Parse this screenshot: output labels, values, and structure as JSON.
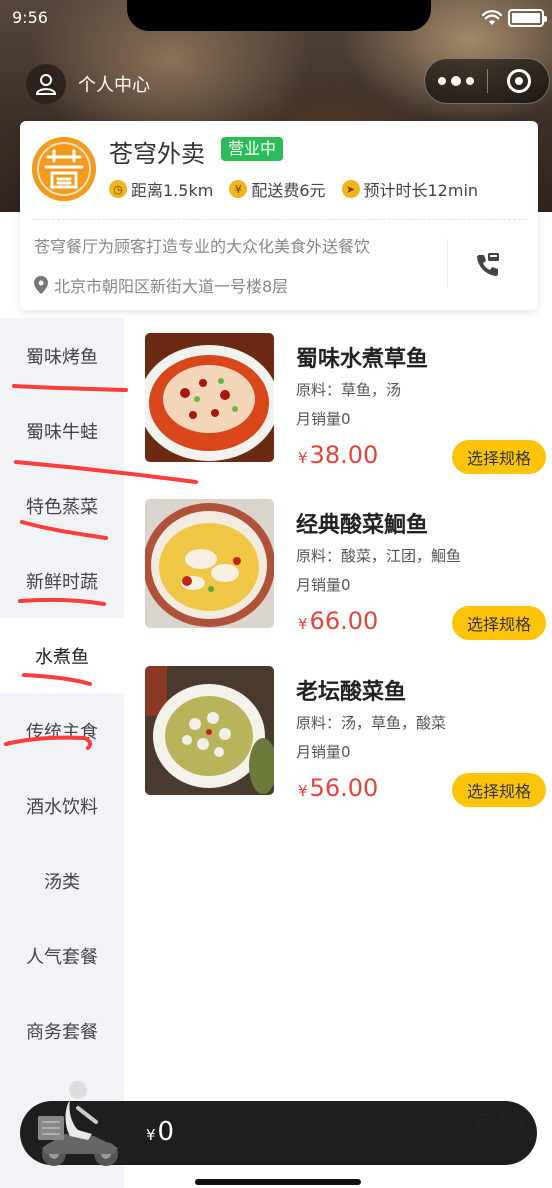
{
  "status_bar": {
    "time": "9:56"
  },
  "header": {
    "user_center_label": "个人中心"
  },
  "shop": {
    "name": "苍穹外卖",
    "status_badge": "营业中",
    "distance": "距离1.5km",
    "delivery_fee": "配送费6元",
    "eta": "预计时长12min",
    "description": "苍穹餐厅为顾客打造专业的大众化美食外送餐饮",
    "address": "北京市朝阳区新街大道一号楼8层"
  },
  "categories": [
    {
      "label": "蜀味烤鱼",
      "active": false
    },
    {
      "label": "蜀味牛蛙",
      "active": false
    },
    {
      "label": "特色蒸菜",
      "active": false
    },
    {
      "label": "新鲜时蔬",
      "active": false
    },
    {
      "label": "水煮鱼",
      "active": true
    },
    {
      "label": "传统主食",
      "active": false
    },
    {
      "label": "酒水饮料",
      "active": false
    },
    {
      "label": "汤类",
      "active": false
    },
    {
      "label": "人气套餐",
      "active": false
    },
    {
      "label": "商务套餐",
      "active": false
    }
  ],
  "dishes": [
    {
      "name": "蜀味水煮草鱼",
      "ingredients": "原料：草鱼，汤",
      "sales": "月销量0",
      "currency": "¥",
      "price": "38.00",
      "button": "选择规格"
    },
    {
      "name": "经典酸菜鮰鱼",
      "ingredients": "原料：酸菜，江团，鮰鱼",
      "sales": "月销量0",
      "currency": "¥",
      "price": "66.00",
      "button": "选择规格"
    },
    {
      "name": "老坛酸菜鱼",
      "ingredients": "原料：汤，草鱼，酸菜",
      "sales": "月销量0",
      "currency": "¥",
      "price": "56.00",
      "button": "选择规格"
    }
  ],
  "cart": {
    "currency": "¥",
    "total": "0",
    "checkout_label": "去结算"
  },
  "colors": {
    "accent_yellow": "#fdc40a",
    "price_red": "#e8423b",
    "open_green": "#2bbd5a",
    "logo_orange": "#f39a1e",
    "annotation_red": "#ff3b3b"
  }
}
